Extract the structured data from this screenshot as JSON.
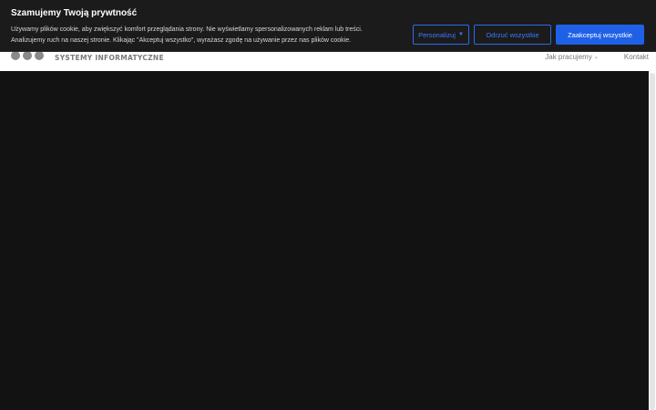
{
  "cookie_banner": {
    "title": "Szamujemy Twoją prywtność",
    "text_line1": "Używamy plików cookie, aby zwiększyć komfort przeglądania strony. Nie wyświetlamy spersonalizowanych reklam lub treści.",
    "text_line2": "Analizujemy ruch na naszej stronie. Klikając \"Akceptuj wszystko\", wyrażasz zgodę na używanie przez nas plików cookie.",
    "personalize_label": "Personalizuj",
    "reject_label": "Odrzuć wszystkie",
    "accept_label": "Zaakceptuj wszystkie"
  },
  "header": {
    "logo_text": "SYSTEMY INFORMATYCZNE",
    "nav": {
      "how_we_work": "Jak pracujemy",
      "contact": "Kontakt"
    }
  },
  "icons": {
    "personalize_caret": "caret-down-icon",
    "nav_chevron": "chevron-down-icon"
  },
  "colors": {
    "banner_bg": "#1b1b1b",
    "accent": "#1f61e6",
    "hero_bg": "#121212"
  }
}
